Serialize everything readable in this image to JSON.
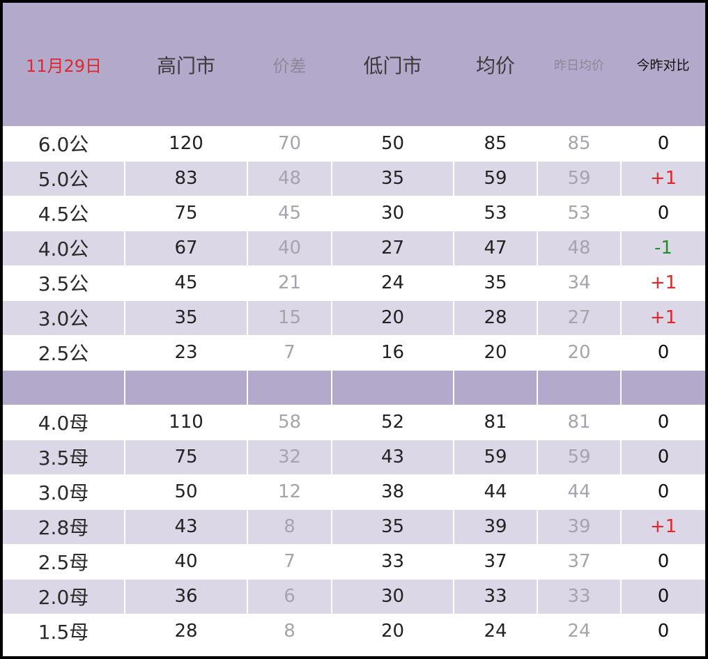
{
  "header": {
    "date": "11月29日",
    "high_market": "高门市",
    "price_diff": "价差",
    "low_market": "低门市",
    "avg_price": "均价",
    "yesterday_avg": "昨日均价",
    "compare": "今昨对比"
  },
  "colors": {
    "header_bg": "#b3a9ca",
    "alt_row_bg": "#dcd7e6",
    "up": "#e0262b",
    "down": "#1f8f24"
  },
  "male_rows": [
    {
      "spec": "6.0公",
      "high": "120",
      "diff": "70",
      "low": "50",
      "avg": "85",
      "yest": "85",
      "cmp": "0"
    },
    {
      "spec": "5.0公",
      "high": "83",
      "diff": "48",
      "low": "35",
      "avg": "59",
      "yest": "59",
      "cmp": "+1"
    },
    {
      "spec": "4.5公",
      "high": "75",
      "diff": "45",
      "low": "30",
      "avg": "53",
      "yest": "53",
      "cmp": "0"
    },
    {
      "spec": "4.0公",
      "high": "67",
      "diff": "40",
      "low": "27",
      "avg": "47",
      "yest": "48",
      "cmp": "-1"
    },
    {
      "spec": "3.5公",
      "high": "45",
      "diff": "21",
      "low": "24",
      "avg": "35",
      "yest": "34",
      "cmp": "+1"
    },
    {
      "spec": "3.0公",
      "high": "35",
      "diff": "15",
      "low": "20",
      "avg": "28",
      "yest": "27",
      "cmp": "+1"
    },
    {
      "spec": "2.5公",
      "high": "23",
      "diff": "7",
      "low": "16",
      "avg": "20",
      "yest": "20",
      "cmp": "0"
    }
  ],
  "female_rows": [
    {
      "spec": "4.0母",
      "high": "110",
      "diff": "58",
      "low": "52",
      "avg": "81",
      "yest": "81",
      "cmp": "0"
    },
    {
      "spec": "3.5母",
      "high": "75",
      "diff": "32",
      "low": "43",
      "avg": "59",
      "yest": "59",
      "cmp": "0"
    },
    {
      "spec": "3.0母",
      "high": "50",
      "diff": "12",
      "low": "38",
      "avg": "44",
      "yest": "44",
      "cmp": "0"
    },
    {
      "spec": "2.8母",
      "high": "43",
      "diff": "8",
      "low": "35",
      "avg": "39",
      "yest": "39",
      "cmp": "+1"
    },
    {
      "spec": "2.5母",
      "high": "40",
      "diff": "7",
      "low": "33",
      "avg": "37",
      "yest": "37",
      "cmp": "0"
    },
    {
      "spec": "2.0母",
      "high": "36",
      "diff": "6",
      "low": "30",
      "avg": "33",
      "yest": "33",
      "cmp": "0"
    },
    {
      "spec": "1.5母",
      "high": "28",
      "diff": "8",
      "low": "20",
      "avg": "24",
      "yest": "24",
      "cmp": "0"
    }
  ]
}
